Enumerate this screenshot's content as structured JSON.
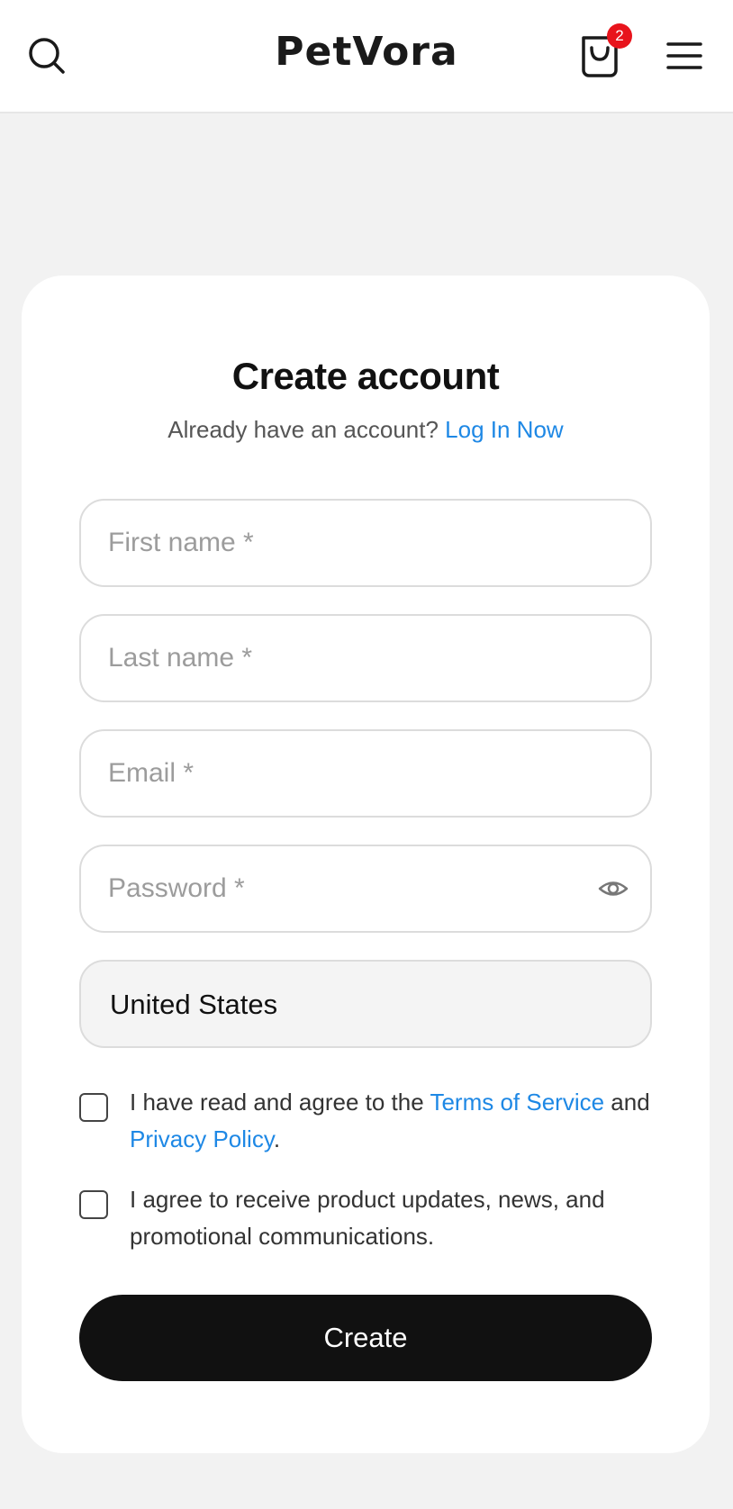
{
  "header": {
    "logo": "PetVora",
    "cart_count": "2",
    "icons": {
      "search": "search-icon",
      "cart": "shopping-bag-icon",
      "menu": "hamburger-menu-icon"
    }
  },
  "form": {
    "title": "Create account",
    "subtitle_text": "Already have an account?",
    "login_link": "Log In Now",
    "first_name_placeholder": "First name *",
    "last_name_placeholder": "Last name *",
    "email_placeholder": "Email *",
    "password_placeholder": "Password *",
    "country_value": "United States",
    "terms": {
      "before": "I have read and agree to the ",
      "terms_link": "Terms of Service",
      "middle": " and ",
      "privacy_link": "Privacy Policy",
      "after": "."
    },
    "marketing_text": "I agree to receive product updates, news, and promotional communications.",
    "submit_label": "Create"
  },
  "colors": {
    "page_background": "#f2f2f2",
    "link": "#1e88e5",
    "badge": "#e8141c",
    "button": "#111111"
  }
}
